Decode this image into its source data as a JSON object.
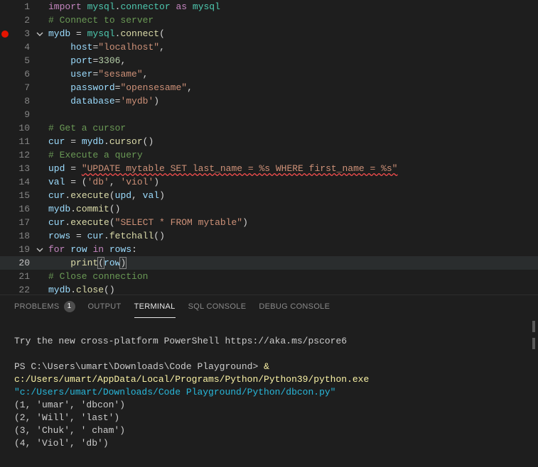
{
  "code": {
    "lines": [
      {
        "n": 1,
        "txt": ""
      },
      {
        "n": 2,
        "txt": ""
      },
      {
        "n": 3,
        "txt": "",
        "bp": true,
        "fold": true
      },
      {
        "n": 4,
        "txt": ""
      },
      {
        "n": 5,
        "txt": ""
      },
      {
        "n": 6,
        "txt": ""
      },
      {
        "n": 7,
        "txt": ""
      },
      {
        "n": 8,
        "txt": ""
      },
      {
        "n": 9,
        "txt": ""
      },
      {
        "n": 10,
        "txt": ""
      },
      {
        "n": 11,
        "txt": ""
      },
      {
        "n": 12,
        "txt": ""
      },
      {
        "n": 13,
        "txt": ""
      },
      {
        "n": 14,
        "txt": ""
      },
      {
        "n": 15,
        "txt": ""
      },
      {
        "n": 16,
        "txt": ""
      },
      {
        "n": 17,
        "txt": ""
      },
      {
        "n": 18,
        "txt": ""
      },
      {
        "n": 19,
        "txt": "",
        "fold": true
      },
      {
        "n": 20,
        "txt": "",
        "sel": true
      },
      {
        "n": 21,
        "txt": ""
      },
      {
        "n": 22,
        "txt": ""
      }
    ],
    "l1": {
      "import": "import",
      "mod1": "mysql",
      "connector": "connector",
      "as": "as",
      "mod2": "mysql"
    },
    "l2": {
      "comment": "# Connect to server"
    },
    "l3": {
      "mydb": "mydb",
      "eq": " = ",
      "mysql": "mysql",
      "connect": "connect",
      "p": "("
    },
    "l4": {
      "host": "host",
      "eq": "=",
      "val": "\"localhost\"",
      "c": ","
    },
    "l5": {
      "port": "port",
      "eq": "=",
      "val": "3306",
      "c": ","
    },
    "l6": {
      "user": "user",
      "eq": "=",
      "val": "\"sesame\"",
      "c": ","
    },
    "l7": {
      "password": "password",
      "eq": "=",
      "val": "\"opensesame\"",
      "c": ","
    },
    "l8": {
      "database": "database",
      "eq": "=",
      "val": "'mydb'",
      "p": ")"
    },
    "l10": {
      "comment": "# Get a cursor"
    },
    "l11": {
      "cur": "cur",
      "eq": " = ",
      "mydb": "mydb",
      "cursor": "cursor",
      "p": "()"
    },
    "l12": {
      "comment": "# Execute a query"
    },
    "l13": {
      "upd": "upd",
      "eq": " = ",
      "str": "\"UPDATE mytable SET last_name = %s WHERE first_name = %s\""
    },
    "l14": {
      "val": "val",
      "eq": " = (",
      "s1": "'db'",
      "c": ", ",
      "s2": "'viol'",
      "p": ")"
    },
    "l15": {
      "cur": "cur",
      "execute": "execute",
      "p1": "(",
      "upd": "upd",
      "c": ", ",
      "vv": "val",
      "p2": ")"
    },
    "l16": {
      "mydb": "mydb",
      "commit": "commit",
      "p": "()"
    },
    "l17": {
      "cur": "cur",
      "execute": "execute",
      "p1": "(",
      "str": "\"SELECT * FROM mytable\"",
      "p2": ")"
    },
    "l18": {
      "rows": "rows",
      "eq": " = ",
      "cur": "cur",
      "fetchall": "fetchall",
      "p": "()"
    },
    "l19": {
      "for": "for",
      "row": "row",
      "in": "in",
      "rows": "rows",
      "c": ":"
    },
    "l20": {
      "print": "print",
      "p1": "(",
      "row": "row",
      "p2": ")"
    },
    "l21": {
      "comment": "# Close connection"
    },
    "l22": {
      "mydb": "mydb",
      "close": "close",
      "p": "()"
    }
  },
  "panel": {
    "tabs": {
      "problems": "PROBLEMS",
      "problems_count": "1",
      "output": "OUTPUT",
      "terminal": "TERMINAL",
      "sql": "SQL CONSOLE",
      "debug": "DEBUG CONSOLE"
    }
  },
  "terminal": {
    "try_line": "Try the new cross-platform PowerShell https://aka.ms/pscore6",
    "prompt": "PS C:\\Users\\umart\\Downloads\\Code Playground> ",
    "amp": "& ",
    "exe": "c:/Users/umart/AppData/Local/Programs/Python/Python39/python.exe ",
    "script": "\"c:/Users/umart/Downloads/Code Playground/Python/dbcon.py\"",
    "out1": "(1, 'umar', 'dbcon')",
    "out2": "(2, 'Will', 'last')",
    "out3": "(3, 'Chuk', ' cham')",
    "out4": "(4, 'Viol', 'db')"
  }
}
